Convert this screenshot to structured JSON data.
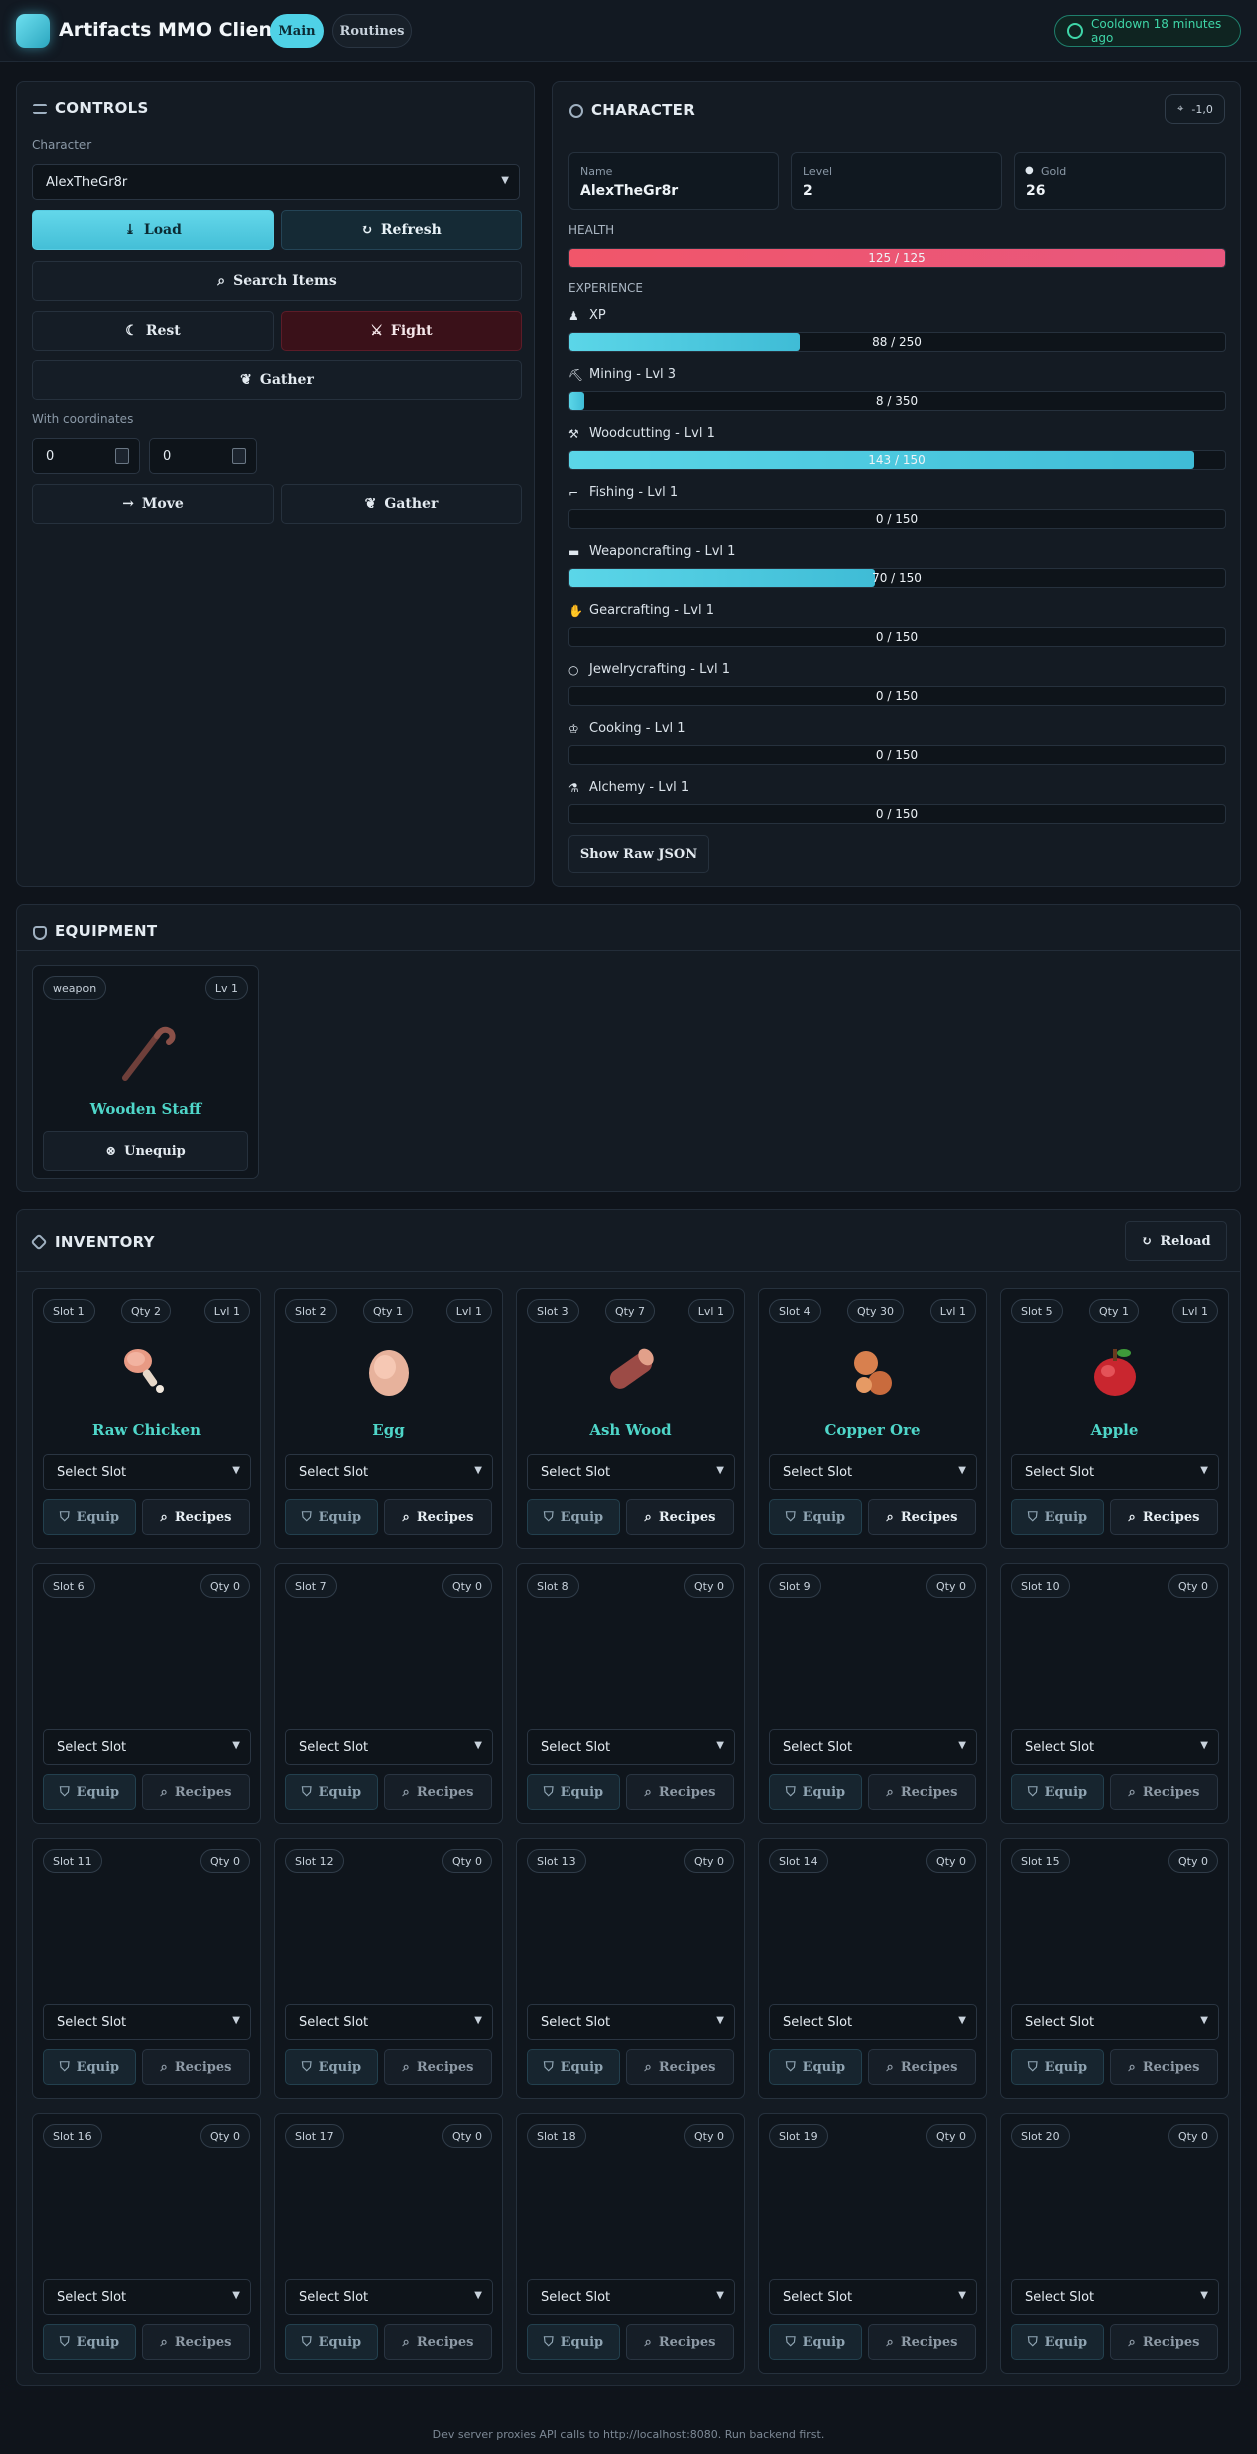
{
  "app": {
    "title": "Artifacts MMO Client"
  },
  "nav": {
    "tabs": [
      {
        "label": "Main"
      },
      {
        "label": "Routines"
      }
    ]
  },
  "cooldown": {
    "text": "Cooldown 18 minutes ago"
  },
  "controls": {
    "title": "CONTROLS",
    "character_label": "Character",
    "character_value": "AlexTheGr8r",
    "load": "Load",
    "refresh": "Refresh",
    "search_items": "Search Items",
    "rest": "Rest",
    "fight": "Fight",
    "gather": "Gather",
    "coords_label": "With coordinates",
    "x": "0",
    "y": "0",
    "move": "Move",
    "gather2": "Gather"
  },
  "character": {
    "title": "CHARACTER",
    "position": "-1,0",
    "name_label": "Name",
    "name": "AlexTheGr8r",
    "level_label": "Level",
    "level": "2",
    "gold_label": "Gold",
    "gold": "26",
    "health_label": "HEALTH",
    "health_text": "125 / 125",
    "health_fraction": 1.0,
    "experience_label": "EXPERIENCE",
    "skills": [
      {
        "label": "XP",
        "icon": "user-icon",
        "text": "88 / 250",
        "fraction": 0.352
      },
      {
        "label": "Mining - Lvl 3",
        "icon": "pickaxe-icon",
        "text": "8 / 350",
        "fraction": 0.023
      },
      {
        "label": "Woodcutting - Lvl 1",
        "icon": "axe-icon",
        "text": "143 / 150",
        "fraction": 0.953
      },
      {
        "label": "Fishing - Lvl 1",
        "icon": "fishing-rod-icon",
        "text": "0 / 150",
        "fraction": 0
      },
      {
        "label": "Weaponcrafting - Lvl 1",
        "icon": "anvil-icon",
        "text": "70 / 150",
        "fraction": 0.467
      },
      {
        "label": "Gearcrafting - Lvl 1",
        "icon": "hand-icon",
        "text": "0 / 150",
        "fraction": 0
      },
      {
        "label": "Jewelrycrafting - Lvl 1",
        "icon": "ring-icon",
        "text": "0 / 150",
        "fraction": 0
      },
      {
        "label": "Cooking - Lvl 1",
        "icon": "chef-hat-icon",
        "text": "0 / 150",
        "fraction": 0
      },
      {
        "label": "Alchemy - Lvl 1",
        "icon": "flask-icon",
        "text": "0 / 150",
        "fraction": 0
      }
    ],
    "raw_json": "Show Raw JSON"
  },
  "equipment": {
    "title": "EQUIPMENT",
    "items": [
      {
        "slot": "weapon",
        "level": "Lv 1",
        "name": "Wooden Staff",
        "action": "Unequip"
      }
    ]
  },
  "inventory": {
    "title": "INVENTORY",
    "reload": "Reload",
    "select_placeholder": "Select Slot",
    "equip": "Equip",
    "recipes": "Recipes",
    "slots": [
      {
        "slot": "Slot 1",
        "qty": "Qty 2",
        "lvl": "Lvl 1",
        "name": "Raw Chicken",
        "sprite": "chicken"
      },
      {
        "slot": "Slot 2",
        "qty": "Qty 1",
        "lvl": "Lvl 1",
        "name": "Egg",
        "sprite": "egg"
      },
      {
        "slot": "Slot 3",
        "qty": "Qty 7",
        "lvl": "Lvl 1",
        "name": "Ash Wood",
        "sprite": "wood"
      },
      {
        "slot": "Slot 4",
        "qty": "Qty 30",
        "lvl": "Lvl 1",
        "name": "Copper Ore",
        "sprite": "ore"
      },
      {
        "slot": "Slot 5",
        "qty": "Qty 1",
        "lvl": "Lvl 1",
        "name": "Apple",
        "sprite": "apple"
      },
      {
        "slot": "Slot 6",
        "qty": "Qty 0"
      },
      {
        "slot": "Slot 7",
        "qty": "Qty 0"
      },
      {
        "slot": "Slot 8",
        "qty": "Qty 0"
      },
      {
        "slot": "Slot 9",
        "qty": "Qty 0"
      },
      {
        "slot": "Slot 10",
        "qty": "Qty 0"
      },
      {
        "slot": "Slot 11",
        "qty": "Qty 0"
      },
      {
        "slot": "Slot 12",
        "qty": "Qty 0"
      },
      {
        "slot": "Slot 13",
        "qty": "Qty 0"
      },
      {
        "slot": "Slot 14",
        "qty": "Qty 0"
      },
      {
        "slot": "Slot 15",
        "qty": "Qty 0"
      },
      {
        "slot": "Slot 16",
        "qty": "Qty 0"
      },
      {
        "slot": "Slot 17",
        "qty": "Qty 0"
      },
      {
        "slot": "Slot 18",
        "qty": "Qty 0"
      },
      {
        "slot": "Slot 19",
        "qty": "Qty 0"
      },
      {
        "slot": "Slot 20",
        "qty": "Qty 0"
      }
    ]
  },
  "footer": {
    "text": "Dev server proxies API calls to http://localhost:8080. Run backend first."
  },
  "colors": {
    "accent": "#4fd1e6",
    "danger": "#3a1119",
    "health": "#f1566a",
    "item_name": "#4fd6c9"
  }
}
